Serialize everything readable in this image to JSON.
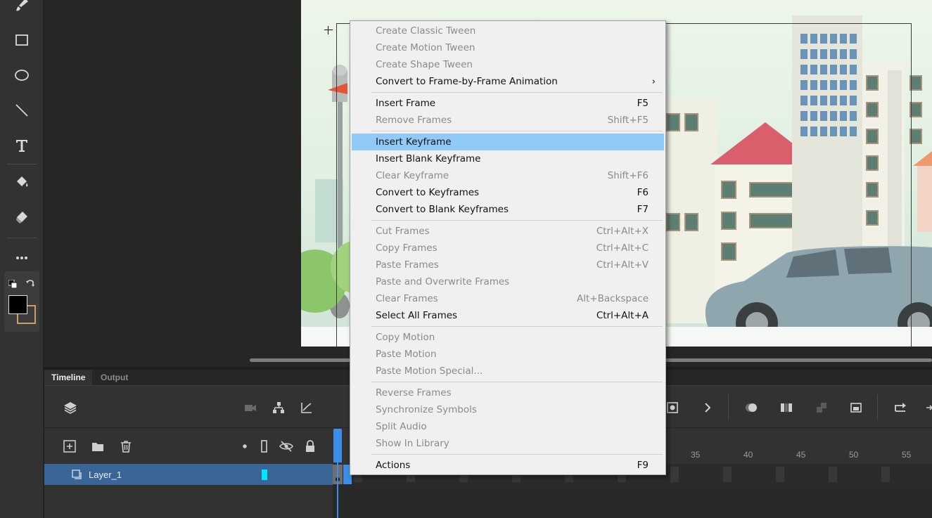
{
  "timeline_tabs": [
    {
      "label": "Timeline",
      "active": true
    },
    {
      "label": "Output",
      "active": false
    }
  ],
  "layer": {
    "name": "Layer_1",
    "color": "#00e5ff"
  },
  "ruler_labels": [
    "35",
    "40",
    "45",
    "50",
    "55"
  ],
  "menu_groups": [
    [
      {
        "label": "Create Classic Tween",
        "shortcut": "",
        "enabled": false
      },
      {
        "label": "Create Motion Tween",
        "shortcut": "",
        "enabled": false
      },
      {
        "label": "Create Shape Tween",
        "shortcut": "",
        "enabled": false
      },
      {
        "label": "Convert to Frame-by-Frame Animation",
        "shortcut": "",
        "enabled": true,
        "submenu": true
      }
    ],
    [
      {
        "label": "Insert Frame",
        "shortcut": "F5",
        "enabled": true
      },
      {
        "label": "Remove Frames",
        "shortcut": "Shift+F5",
        "enabled": false
      }
    ],
    [
      {
        "label": "Insert Keyframe",
        "shortcut": "",
        "enabled": true,
        "highlighted": true
      },
      {
        "label": "Insert Blank Keyframe",
        "shortcut": "",
        "enabled": true
      },
      {
        "label": "Clear Keyframe",
        "shortcut": "Shift+F6",
        "enabled": false
      },
      {
        "label": "Convert to Keyframes",
        "shortcut": "F6",
        "enabled": true
      },
      {
        "label": "Convert to Blank Keyframes",
        "shortcut": "F7",
        "enabled": true
      }
    ],
    [
      {
        "label": "Cut Frames",
        "shortcut": "Ctrl+Alt+X",
        "enabled": false
      },
      {
        "label": "Copy Frames",
        "shortcut": "Ctrl+Alt+C",
        "enabled": false
      },
      {
        "label": "Paste Frames",
        "shortcut": "Ctrl+Alt+V",
        "enabled": false
      },
      {
        "label": "Paste and Overwrite Frames",
        "shortcut": "",
        "enabled": false
      },
      {
        "label": "Clear Frames",
        "shortcut": "Alt+Backspace",
        "enabled": false
      },
      {
        "label": "Select All Frames",
        "shortcut": "Ctrl+Alt+A",
        "enabled": true
      }
    ],
    [
      {
        "label": "Copy Motion",
        "shortcut": "",
        "enabled": false
      },
      {
        "label": "Paste Motion",
        "shortcut": "",
        "enabled": false
      },
      {
        "label": "Paste Motion Special...",
        "shortcut": "",
        "enabled": false
      }
    ],
    [
      {
        "label": "Reverse Frames",
        "shortcut": "",
        "enabled": false
      },
      {
        "label": "Synchronize Symbols",
        "shortcut": "",
        "enabled": false
      },
      {
        "label": "Split Audio",
        "shortcut": "",
        "enabled": false
      },
      {
        "label": "Show In Library",
        "shortcut": "",
        "enabled": false
      }
    ],
    [
      {
        "label": "Actions",
        "shortcut": "F9",
        "enabled": true
      }
    ]
  ],
  "submenu_glyph": "›",
  "colors": {
    "menu_highlight": "#91c9f7",
    "layer_selected": "#3a6597",
    "playhead": "#3d8ee6",
    "stroke_color": "#000000",
    "fill_color": "#c8a064"
  }
}
